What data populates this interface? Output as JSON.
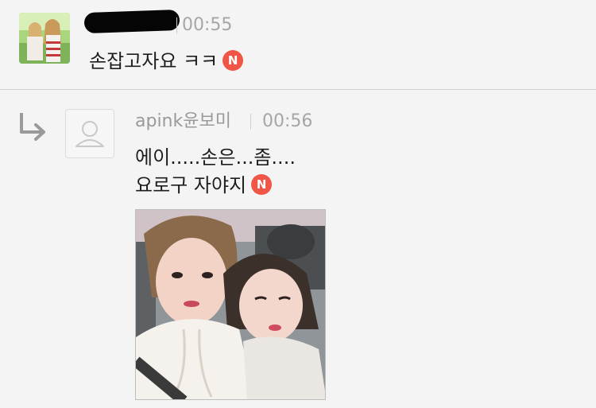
{
  "comments": [
    {
      "author": "",
      "time": "00:55",
      "text": "손잡고자요 ㅋㅋ",
      "badge": "N"
    },
    {
      "author": "apink윤보미",
      "time": "00:56",
      "lines": [
        "에이.....손은...좀....",
        "요로구 자야지"
      ],
      "badge": "N"
    }
  ],
  "icons": {
    "reply": "reply-arrow-icon",
    "default_avatar": "default-profile-icon",
    "new": "new-badge-icon"
  },
  "colors": {
    "background": "#f4f4f4",
    "meta_text": "#a6a6a6",
    "new_badge": "#ef5646",
    "divider": "#cfcfcf"
  }
}
